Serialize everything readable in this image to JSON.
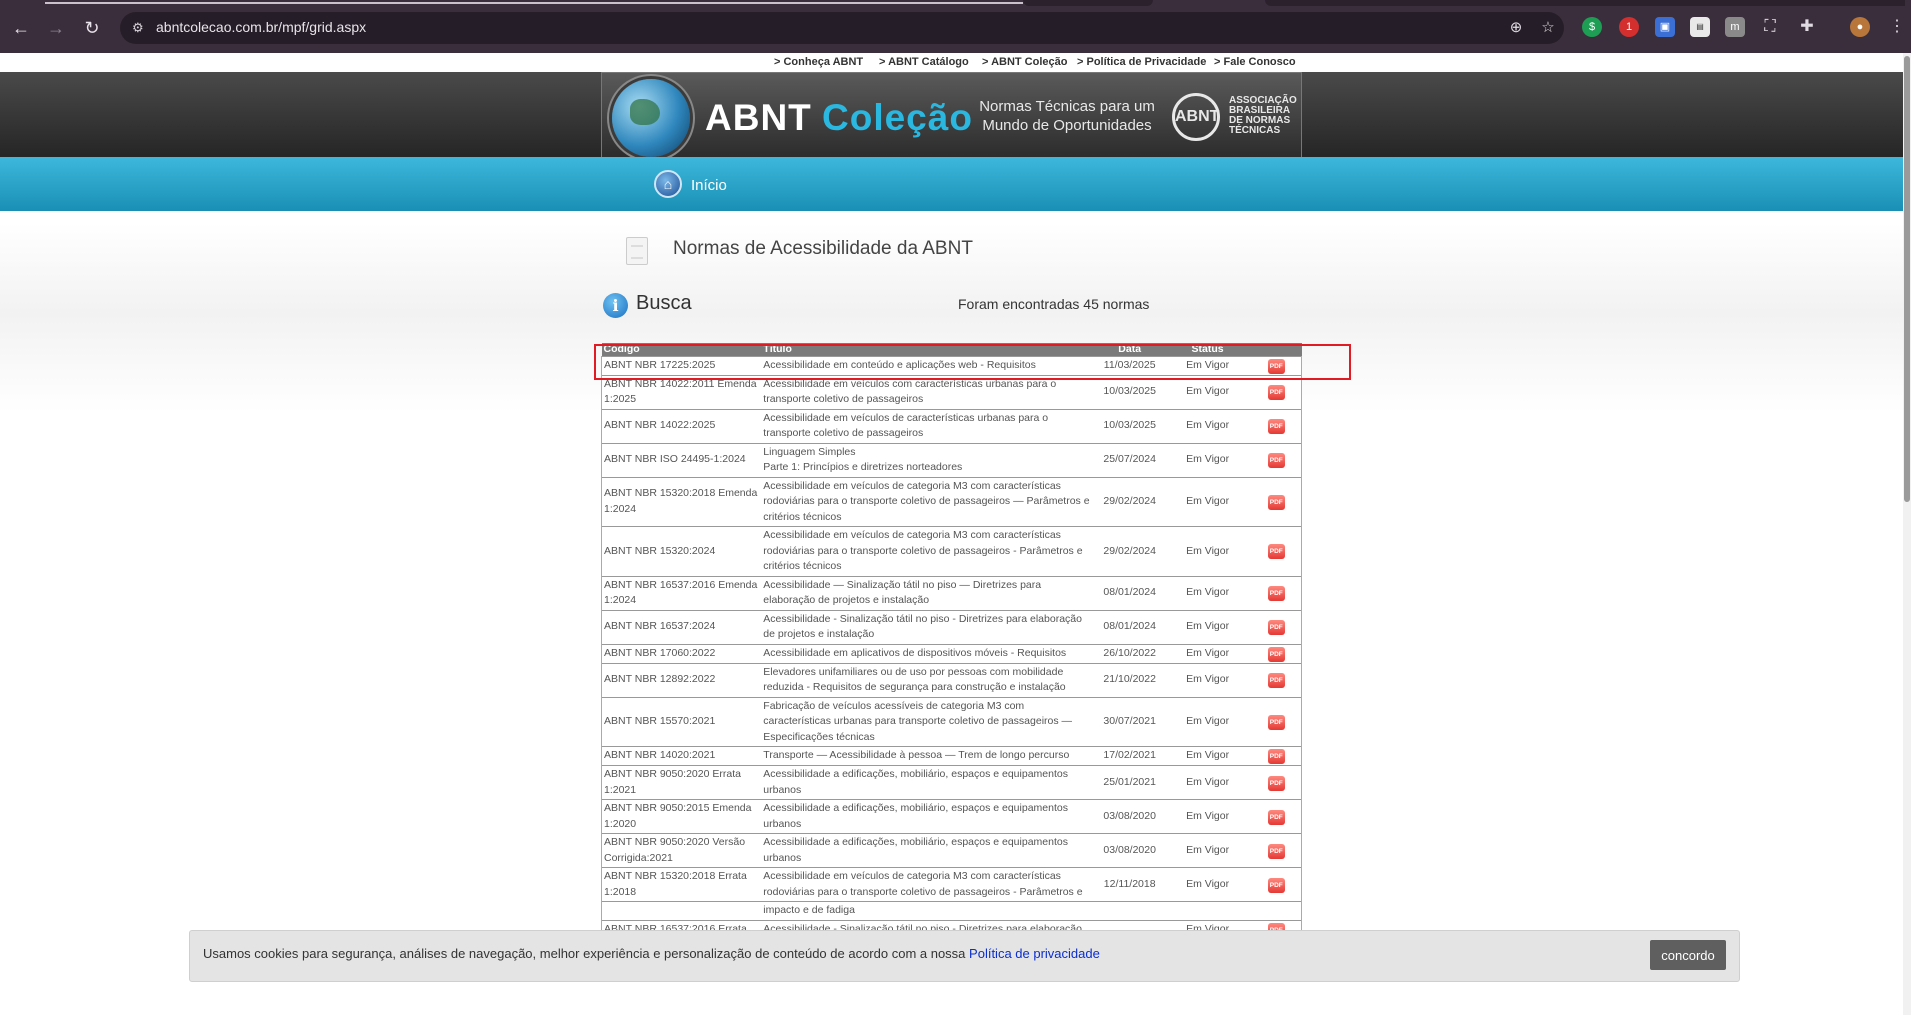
{
  "browser": {
    "url": "abntcolecao.com.br/mpf/grid.aspx",
    "back_glyph": "←",
    "forward_glyph": "→",
    "reload_glyph": "↻",
    "zoom_glyph": "⊕",
    "star_glyph": "☆",
    "ext_badge": "1"
  },
  "toplinks": [
    "> Conheça ABNT",
    "> ABNT Catálogo",
    "> ABNT Coleção",
    "> Política de Privacidade",
    "> Fale Conosco"
  ],
  "header": {
    "logo_abnt": "ABNT",
    "logo_colecao": "Coleção",
    "tagline_line1": "Normas Técnicas para um",
    "tagline_line2": "Mundo de Oportunidades",
    "seal_text": "ABNT",
    "assoc_line1": "ASSOCIAÇÃO",
    "assoc_line2": "BRASILEIRA",
    "assoc_line3": "DE NORMAS",
    "assoc_line4": "TÉCNICAS"
  },
  "nav": {
    "home": "Início"
  },
  "page": {
    "title": "Normas de Acessibilidade da ABNT",
    "search_heading": "Busca",
    "found_text": "Foram encontradas 45 normas"
  },
  "table": {
    "headers": {
      "codigo": "Código",
      "titulo": "Título",
      "data": "Data",
      "status": "Status"
    },
    "pdf_label": "PDF",
    "rows": [
      {
        "codigo": "ABNT NBR 17225:2025",
        "titulo": "Acessibilidade em conteúdo e aplicações web - Requisitos",
        "data": "11/03/2025",
        "status": "Em Vigor"
      },
      {
        "codigo": "ABNT NBR 14022:2011 Emenda 1:2025",
        "titulo": "Acessibilidade em veículos com características urbanas para o transporte coletivo de passageiros",
        "data": "10/03/2025",
        "status": "Em Vigor"
      },
      {
        "codigo": "ABNT NBR 14022:2025",
        "titulo": "Acessibilidade em veículos de características urbanas para o transporte coletivo de passageiros",
        "data": "10/03/2025",
        "status": "Em Vigor"
      },
      {
        "codigo": "ABNT NBR ISO 24495-1:2024",
        "titulo": "Linguagem Simples\nParte 1: Princípios e diretrizes norteadores",
        "data": "25/07/2024",
        "status": "Em Vigor"
      },
      {
        "codigo": "ABNT NBR 15320:2018 Emenda 1:2024",
        "titulo": "Acessibilidade em veículos de categoria M3 com características rodoviárias para o transporte coletivo de passageiros — Parâmetros e critérios técnicos",
        "data": "29/02/2024",
        "status": "Em Vigor"
      },
      {
        "codigo": "ABNT NBR 15320:2024",
        "titulo": "Acessibilidade em veículos de categoria M3 com características rodoviárias para o transporte coletivo de passageiros - Parâmetros e critérios técnicos",
        "data": "29/02/2024",
        "status": "Em Vigor"
      },
      {
        "codigo": "ABNT NBR 16537:2016 Emenda 1:2024",
        "titulo": "Acessibilidade — Sinalização tátil no piso — Diretrizes para elaboração de projetos e instalação",
        "data": "08/01/2024",
        "status": "Em Vigor"
      },
      {
        "codigo": "ABNT NBR 16537:2024",
        "titulo": "Acessibilidade - Sinalização tátil no piso - Diretrizes para elaboração de projetos e instalação",
        "data": "08/01/2024",
        "status": "Em Vigor"
      },
      {
        "codigo": "ABNT NBR 17060:2022",
        "titulo": "Acessibilidade em aplicativos de dispositivos móveis - Requisitos",
        "data": "26/10/2022",
        "status": "Em Vigor"
      },
      {
        "codigo": "ABNT NBR 12892:2022",
        "titulo": "Elevadores unifamiliares ou de uso por pessoas com mobilidade reduzida - Requisitos de segurança para construção e instalação",
        "data": "21/10/2022",
        "status": "Em Vigor"
      },
      {
        "codigo": "ABNT NBR 15570:2021",
        "titulo": "Fabricação de veículos acessíveis de categoria M3 com características urbanas para transporte coletivo de passageiros — Especificações técnicas",
        "data": "30/07/2021",
        "status": "Em Vigor"
      },
      {
        "codigo": "ABNT NBR 14020:2021",
        "titulo": "Transporte — Acessibilidade à pessoa — Trem de longo percurso",
        "data": "17/02/2021",
        "status": "Em Vigor"
      },
      {
        "codigo": "ABNT NBR 9050:2020 Errata 1:2021",
        "titulo": "Acessibilidade a edificações, mobiliário, espaços e equipamentos urbanos",
        "data": "25/01/2021",
        "status": "Em Vigor"
      },
      {
        "codigo": "ABNT NBR 9050:2015 Emenda 1:2020",
        "titulo": "Acessibilidade a edificações, mobiliário, espaços e equipamentos urbanos",
        "data": "03/08/2020",
        "status": "Em Vigor"
      },
      {
        "codigo": "ABNT NBR 9050:2020 Versão Corrigida:2021",
        "titulo": "Acessibilidade a edificações, mobiliário, espaços e equipamentos urbanos",
        "data": "03/08/2020",
        "status": "Em Vigor"
      },
      {
        "codigo": "ABNT NBR 15320:2018 Errata 1:2018",
        "titulo": "Acessibilidade em veículos de categoria M3 com características rodoviárias para o transporte coletivo de passageiros - Parâmetros e",
        "data": "12/11/2018",
        "status": "Em Vigor"
      },
      {
        "codigo": "",
        "titulo": "impacto e de fadiga",
        "data": "",
        "status": ""
      },
      {
        "codigo": "ABNT NBR 16537:2016 Errata",
        "titulo": "Acessibilidade - Sinalização tátil no piso - Diretrizes para elaboração",
        "data": "",
        "status": "Em Vigor"
      }
    ]
  },
  "cookie": {
    "text": "Usamos cookies para segurança, análises de navegação, melhor experiência e personalização de conteúdo de acordo com a nossa",
    "link": "Política de privacidade",
    "button": "concordo"
  },
  "colors": {
    "highlight": "#e01b24",
    "accent": "#1a8fb5",
    "pdf": "#e53935"
  }
}
